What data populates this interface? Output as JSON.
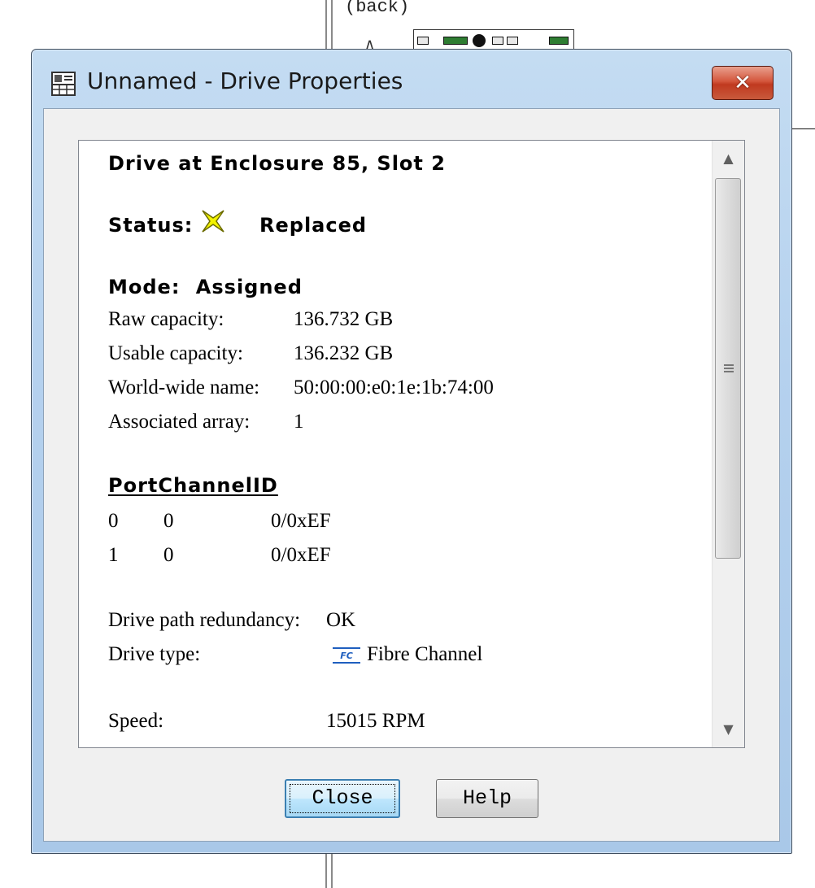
{
  "background": {
    "label": "(back)"
  },
  "dialog": {
    "title": "Unnamed - Drive Properties",
    "close_glyph": "✕",
    "icon": "properties-grid-icon"
  },
  "drive": {
    "heading": "Drive at Enclosure 85, Slot 2",
    "status_label": "Status:",
    "status_icon": "replaced-star-icon",
    "status_value": "Replaced",
    "mode_label": "Mode:",
    "mode_value": "Assigned",
    "properties": [
      {
        "label": "Raw capacity:",
        "value": "136.732 GB"
      },
      {
        "label": "Usable capacity:",
        "value": "136.232 GB"
      },
      {
        "label": "World-wide name:",
        "value": "50:00:00:e0:1e:1b:74:00"
      },
      {
        "label": "Associated array:",
        "value": "1"
      }
    ],
    "port_table": {
      "headers": [
        "Port",
        "Channel",
        "ID"
      ],
      "rows": [
        [
          "0",
          "0",
          "0/0xEF"
        ],
        [
          "1",
          "0",
          "0/0xEF"
        ]
      ]
    },
    "path_redundancy_label": "Drive path redundancy:",
    "path_redundancy_value": "OK",
    "drive_type_label": "Drive type:",
    "drive_type_icon_text": "FC",
    "drive_type_value": "Fibre Channel",
    "speed_label": "Speed:",
    "speed_value": "15015 RPM"
  },
  "buttons": {
    "close": "Close",
    "help": "Help"
  },
  "colors": {
    "status_icon": "#e6e600",
    "fc_icon": "#1f5fbf",
    "titlebar_close": "#c84a30"
  }
}
